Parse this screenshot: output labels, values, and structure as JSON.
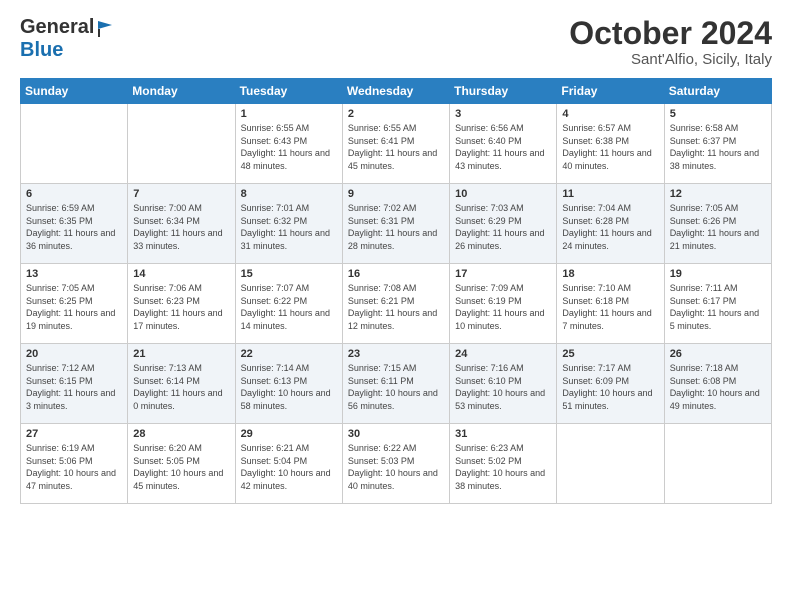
{
  "logo": {
    "general": "General",
    "blue": "Blue"
  },
  "header": {
    "month": "October 2024",
    "location": "Sant'Alfio, Sicily, Italy"
  },
  "days_of_week": [
    "Sunday",
    "Monday",
    "Tuesday",
    "Wednesday",
    "Thursday",
    "Friday",
    "Saturday"
  ],
  "weeks": [
    [
      {
        "day": "",
        "info": ""
      },
      {
        "day": "",
        "info": ""
      },
      {
        "day": "1",
        "info": "Sunrise: 6:55 AM\nSunset: 6:43 PM\nDaylight: 11 hours and 48 minutes."
      },
      {
        "day": "2",
        "info": "Sunrise: 6:55 AM\nSunset: 6:41 PM\nDaylight: 11 hours and 45 minutes."
      },
      {
        "day": "3",
        "info": "Sunrise: 6:56 AM\nSunset: 6:40 PM\nDaylight: 11 hours and 43 minutes."
      },
      {
        "day": "4",
        "info": "Sunrise: 6:57 AM\nSunset: 6:38 PM\nDaylight: 11 hours and 40 minutes."
      },
      {
        "day": "5",
        "info": "Sunrise: 6:58 AM\nSunset: 6:37 PM\nDaylight: 11 hours and 38 minutes."
      }
    ],
    [
      {
        "day": "6",
        "info": "Sunrise: 6:59 AM\nSunset: 6:35 PM\nDaylight: 11 hours and 36 minutes."
      },
      {
        "day": "7",
        "info": "Sunrise: 7:00 AM\nSunset: 6:34 PM\nDaylight: 11 hours and 33 minutes."
      },
      {
        "day": "8",
        "info": "Sunrise: 7:01 AM\nSunset: 6:32 PM\nDaylight: 11 hours and 31 minutes."
      },
      {
        "day": "9",
        "info": "Sunrise: 7:02 AM\nSunset: 6:31 PM\nDaylight: 11 hours and 28 minutes."
      },
      {
        "day": "10",
        "info": "Sunrise: 7:03 AM\nSunset: 6:29 PM\nDaylight: 11 hours and 26 minutes."
      },
      {
        "day": "11",
        "info": "Sunrise: 7:04 AM\nSunset: 6:28 PM\nDaylight: 11 hours and 24 minutes."
      },
      {
        "day": "12",
        "info": "Sunrise: 7:05 AM\nSunset: 6:26 PM\nDaylight: 11 hours and 21 minutes."
      }
    ],
    [
      {
        "day": "13",
        "info": "Sunrise: 7:05 AM\nSunset: 6:25 PM\nDaylight: 11 hours and 19 minutes."
      },
      {
        "day": "14",
        "info": "Sunrise: 7:06 AM\nSunset: 6:23 PM\nDaylight: 11 hours and 17 minutes."
      },
      {
        "day": "15",
        "info": "Sunrise: 7:07 AM\nSunset: 6:22 PM\nDaylight: 11 hours and 14 minutes."
      },
      {
        "day": "16",
        "info": "Sunrise: 7:08 AM\nSunset: 6:21 PM\nDaylight: 11 hours and 12 minutes."
      },
      {
        "day": "17",
        "info": "Sunrise: 7:09 AM\nSunset: 6:19 PM\nDaylight: 11 hours and 10 minutes."
      },
      {
        "day": "18",
        "info": "Sunrise: 7:10 AM\nSunset: 6:18 PM\nDaylight: 11 hours and 7 minutes."
      },
      {
        "day": "19",
        "info": "Sunrise: 7:11 AM\nSunset: 6:17 PM\nDaylight: 11 hours and 5 minutes."
      }
    ],
    [
      {
        "day": "20",
        "info": "Sunrise: 7:12 AM\nSunset: 6:15 PM\nDaylight: 11 hours and 3 minutes."
      },
      {
        "day": "21",
        "info": "Sunrise: 7:13 AM\nSunset: 6:14 PM\nDaylight: 11 hours and 0 minutes."
      },
      {
        "day": "22",
        "info": "Sunrise: 7:14 AM\nSunset: 6:13 PM\nDaylight: 10 hours and 58 minutes."
      },
      {
        "day": "23",
        "info": "Sunrise: 7:15 AM\nSunset: 6:11 PM\nDaylight: 10 hours and 56 minutes."
      },
      {
        "day": "24",
        "info": "Sunrise: 7:16 AM\nSunset: 6:10 PM\nDaylight: 10 hours and 53 minutes."
      },
      {
        "day": "25",
        "info": "Sunrise: 7:17 AM\nSunset: 6:09 PM\nDaylight: 10 hours and 51 minutes."
      },
      {
        "day": "26",
        "info": "Sunrise: 7:18 AM\nSunset: 6:08 PM\nDaylight: 10 hours and 49 minutes."
      }
    ],
    [
      {
        "day": "27",
        "info": "Sunrise: 6:19 AM\nSunset: 5:06 PM\nDaylight: 10 hours and 47 minutes."
      },
      {
        "day": "28",
        "info": "Sunrise: 6:20 AM\nSunset: 5:05 PM\nDaylight: 10 hours and 45 minutes."
      },
      {
        "day": "29",
        "info": "Sunrise: 6:21 AM\nSunset: 5:04 PM\nDaylight: 10 hours and 42 minutes."
      },
      {
        "day": "30",
        "info": "Sunrise: 6:22 AM\nSunset: 5:03 PM\nDaylight: 10 hours and 40 minutes."
      },
      {
        "day": "31",
        "info": "Sunrise: 6:23 AM\nSunset: 5:02 PM\nDaylight: 10 hours and 38 minutes."
      },
      {
        "day": "",
        "info": ""
      },
      {
        "day": "",
        "info": ""
      }
    ]
  ]
}
